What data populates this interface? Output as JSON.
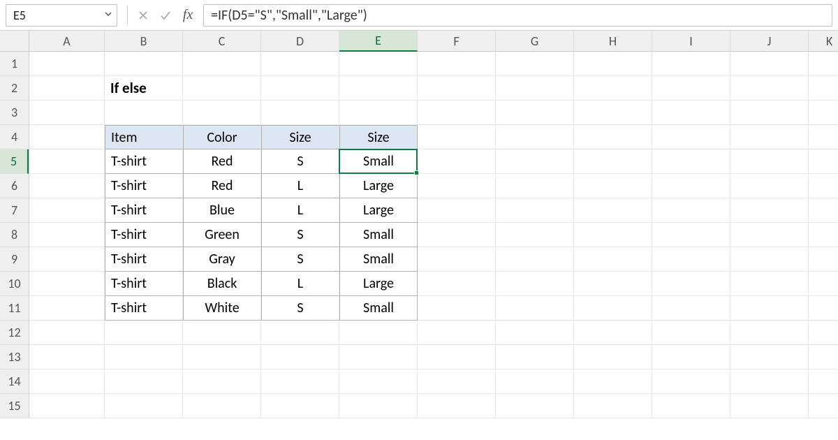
{
  "formula_bar": {
    "cell_ref": "E5",
    "formula": "=IF(D5=\"S\",\"Small\",\"Large\")"
  },
  "columns": [
    "A",
    "B",
    "C",
    "D",
    "E",
    "F",
    "G",
    "H",
    "I",
    "J",
    "K"
  ],
  "selected_col": "E",
  "row_count": 15,
  "selected_row": 5,
  "title": "If else",
  "table": {
    "headers": [
      "Item",
      "Color",
      "Size",
      "Size"
    ],
    "rows": [
      {
        "item": "T-shirt",
        "color": "Red",
        "size": "S",
        "sizeLabel": "Small"
      },
      {
        "item": "T-shirt",
        "color": "Red",
        "size": "L",
        "sizeLabel": "Large"
      },
      {
        "item": "T-shirt",
        "color": "Blue",
        "size": "L",
        "sizeLabel": "Large"
      },
      {
        "item": "T-shirt",
        "color": "Green",
        "size": "S",
        "sizeLabel": "Small"
      },
      {
        "item": "T-shirt",
        "color": "Gray",
        "size": "S",
        "sizeLabel": "Small"
      },
      {
        "item": "T-shirt",
        "color": "Black",
        "size": "L",
        "sizeLabel": "Large"
      },
      {
        "item": "T-shirt",
        "color": "White",
        "size": "S",
        "sizeLabel": "Small"
      }
    ]
  },
  "selection": {
    "colIndex": 4,
    "rowIndex": 4
  }
}
